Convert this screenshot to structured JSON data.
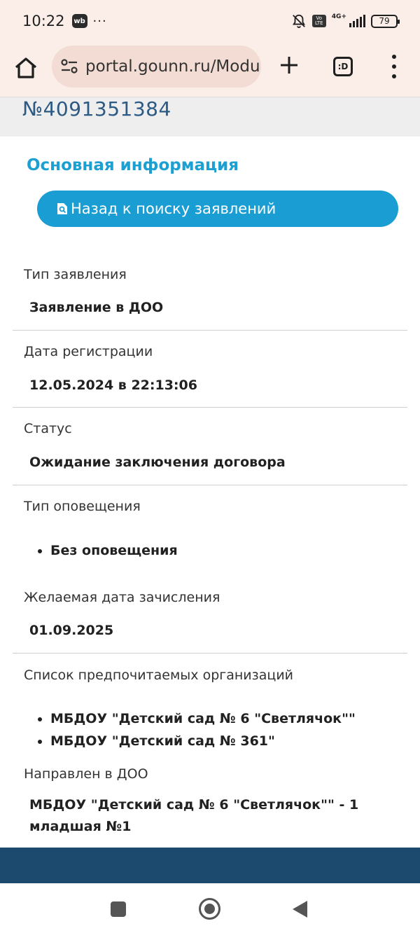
{
  "status_bar": {
    "time": "10:22",
    "app_badge": "wb",
    "more": "···",
    "volte": "Vo LTE",
    "network": "4G+",
    "battery": "79"
  },
  "browser": {
    "url": "portal.gounn.ru/Modu",
    "tabs_label": ":D"
  },
  "header": {
    "application_number": "№4091351384"
  },
  "main": {
    "section_title": "Основная информация",
    "back_button_label": "Назад к поиску заявлений",
    "fields": {
      "type": {
        "label": "Тип заявления",
        "value": "Заявление в ДОО"
      },
      "registration_date": {
        "label": "Дата регистрации",
        "value": "12.05.2024 в 22:13:06"
      },
      "status": {
        "label": "Статус",
        "value": "Ожидание заключения договора"
      },
      "notification": {
        "label": "Тип оповещения",
        "items": [
          "Без оповещения"
        ]
      },
      "desired_date": {
        "label": "Желаемая дата зачисления",
        "value": "01.09.2025"
      },
      "preferred_orgs": {
        "label": "Список предпочитаемых организаций",
        "items": [
          "МБДОУ \"Детский сад № 6 \"Светлячок\"\"",
          "МБДОУ \"Детский сад № 361\""
        ]
      },
      "directed_to": {
        "label": "Направлен в ДОО",
        "value": "МБДОУ \"Детский сад № 6 \"Светлячок\"\" - 1 младшая №1"
      }
    }
  },
  "colors": {
    "accent": "#1a9dd3",
    "header_number": "#2c5a84",
    "footer": "#1c4a6e",
    "browser_chrome": "#fbeee9"
  },
  "icons": {
    "home": "home-icon",
    "site_settings": "tune-icon",
    "new_tab": "plus-icon",
    "tabs": "tab-switcher-icon",
    "menu": "more-vert-icon",
    "back_search": "search-document-icon",
    "mute": "bell-off-icon"
  }
}
